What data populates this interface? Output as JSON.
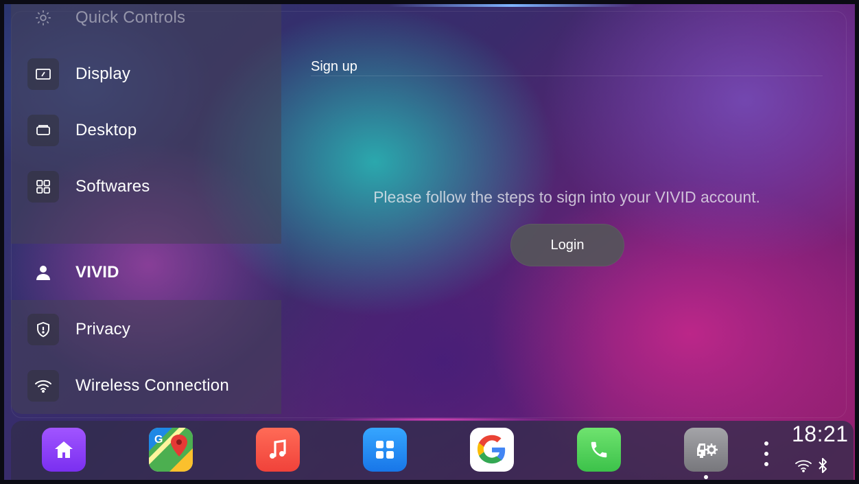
{
  "sidebar": {
    "items": [
      {
        "label": "Quick Controls",
        "icon": "gear-icon"
      },
      {
        "label": "Display",
        "icon": "display-icon"
      },
      {
        "label": "Desktop",
        "icon": "desktop-icon"
      },
      {
        "label": "Softwares",
        "icon": "apps-grid-icon"
      },
      {
        "label": "VIVID",
        "icon": "user-icon"
      },
      {
        "label": "Privacy",
        "icon": "shield-icon"
      },
      {
        "label": "Wireless Connection",
        "icon": "wifi-icon"
      }
    ],
    "active_item": "VIVID"
  },
  "main": {
    "title": "Sign up",
    "message": "Please follow the steps to sign into your VIVID account.",
    "login_label": "Login"
  },
  "dock": {
    "apps": [
      {
        "icon": "home-icon",
        "color": "#8b3ff5"
      },
      {
        "icon": "maps-icon",
        "color": "#34a853"
      },
      {
        "icon": "music-icon",
        "color": "#f25a4a"
      },
      {
        "icon": "app-drawer-icon",
        "color": "#1e8ff5"
      },
      {
        "icon": "google-icon",
        "color": "#ffffff"
      },
      {
        "icon": "phone-icon",
        "color": "#4cd964"
      },
      {
        "icon": "car-settings-icon",
        "color": "#8e8e93"
      }
    ],
    "time": "18:21",
    "status": [
      "wifi-icon",
      "bluetooth-icon"
    ]
  },
  "colors": {
    "accent_purple": "#8b3ff5",
    "login_button_bg": "#55555a"
  }
}
